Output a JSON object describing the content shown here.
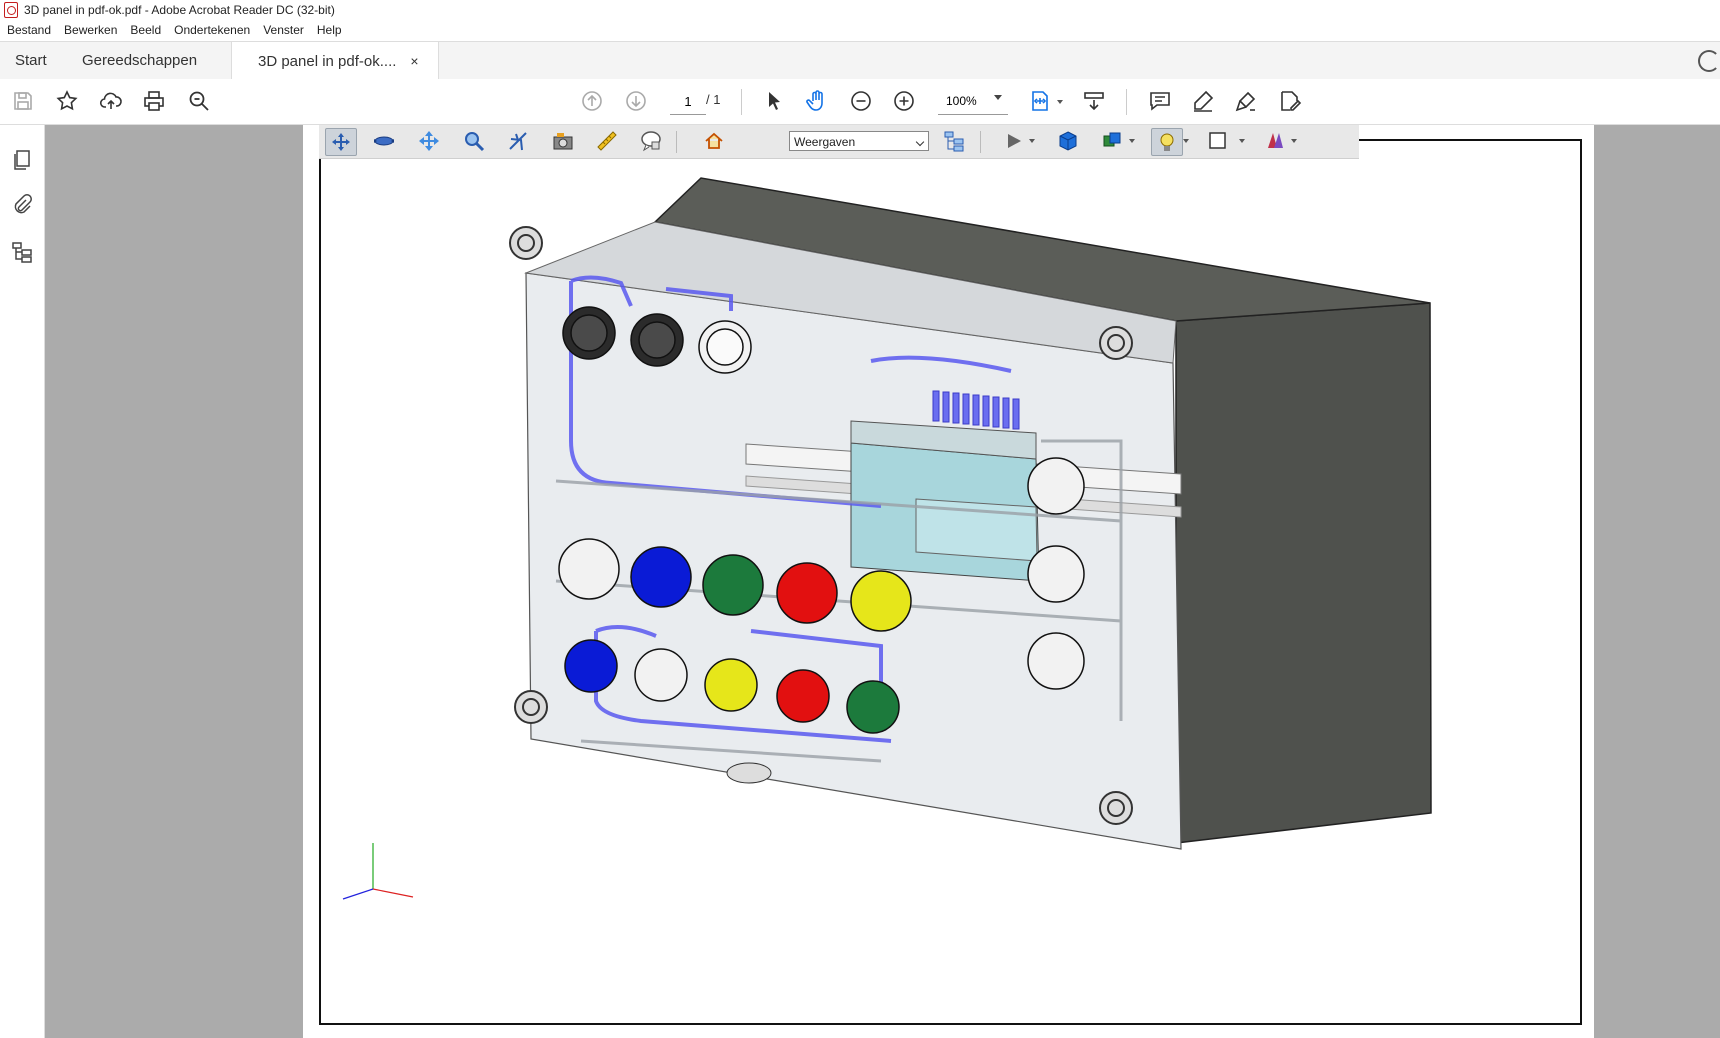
{
  "window": {
    "title": "3D panel in pdf-ok.pdf - Adobe Acrobat Reader DC (32-bit)"
  },
  "menu": [
    "Bestand",
    "Bewerken",
    "Beeld",
    "Ondertekenen",
    "Venster",
    "Help"
  ],
  "tabs": {
    "home": "Start",
    "tools": "Gereedschappen",
    "document": "3D panel in pdf-ok....",
    "close": "×"
  },
  "toolbar": {
    "page_current": "1",
    "page_total": "/ 1",
    "zoom": "100%"
  },
  "toolbar3d": {
    "views_select": "Weergaven"
  },
  "icons": {
    "toolbar": [
      "save-icon",
      "bookmark-star-icon",
      "upload-cloud-icon",
      "print-icon",
      "search-icon",
      "page-up-icon",
      "page-down-icon",
      "select-arrow-icon",
      "hand-pan-icon",
      "zoom-out-icon",
      "zoom-in-icon",
      "fit-page-icon",
      "scroll-mode-icon",
      "comment-icon",
      "highlight-pen-icon",
      "sign-icon",
      "fill-sign-icon"
    ],
    "leftrail": [
      "pages-icon",
      "attachments-icon",
      "layers-model-tree-icon"
    ],
    "toolbar3d": [
      "rotate-icon",
      "spin-icon",
      "pan-icon",
      "zoom-3d-icon",
      "fly-icon",
      "camera-icon",
      "measure-icon",
      "comment-3d-icon",
      "home-view-icon",
      "model-tree-icon",
      "play-icon",
      "render-mode-icon",
      "lighting-icon",
      "background-color-icon",
      "cross-section-icon"
    ]
  },
  "colors": {
    "accent": "#1473e6",
    "toolbar_active": "#cdd3da",
    "pilot_blue": "#0a1bd6",
    "pilot_green": "#1c7a3c",
    "pilot_red": "#e21010",
    "pilot_yellow": "#e6e61a",
    "pilot_white": "#f2f2f2",
    "pilot_black": "#2b2b2b",
    "enclosure_dark": "#4f514d",
    "plc_cyan": "#a8d6dc",
    "wire_blue": "#5a5af0"
  }
}
